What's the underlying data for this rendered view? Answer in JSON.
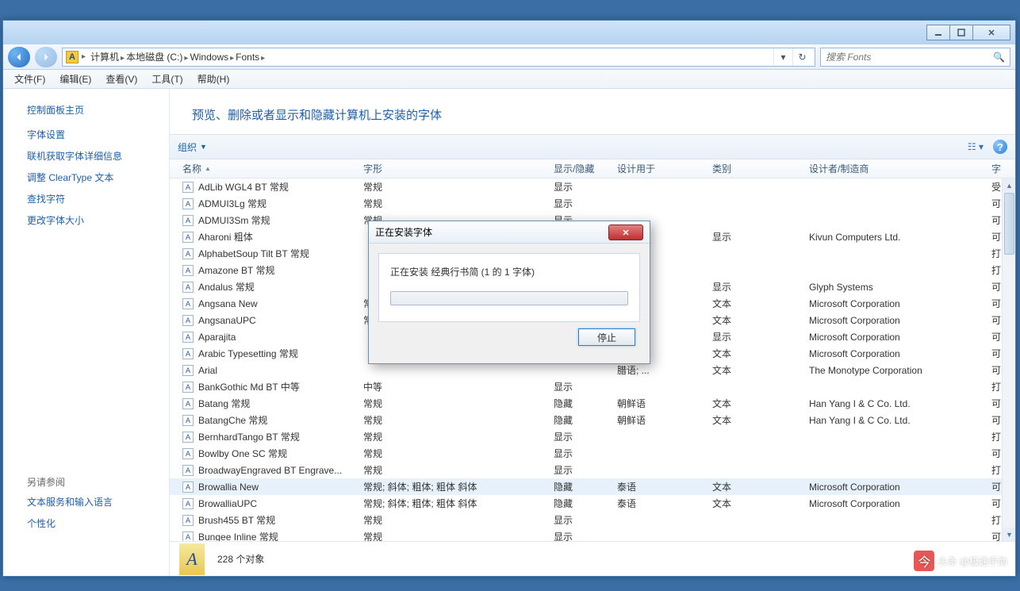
{
  "breadcrumb": [
    "计算机",
    "本地磁盘 (C:)",
    "Windows",
    "Fonts"
  ],
  "search_placeholder": "搜索 Fonts",
  "menubar": [
    "文件(F)",
    "编辑(E)",
    "查看(V)",
    "工具(T)",
    "帮助(H)"
  ],
  "sidebar": {
    "home": "控制面板主页",
    "links": [
      "字体设置",
      "联机获取字体详细信息",
      "调整 ClearType 文本",
      "查找字符",
      "更改字体大小"
    ],
    "seealso_label": "另请参阅",
    "seealso": [
      "文本服务和输入语言",
      "个性化"
    ]
  },
  "page_title": "预览、删除或者显示和隐藏计算机上安装的字体",
  "toolbar": {
    "organize": "组织"
  },
  "columns": {
    "name": "名称",
    "style": "字形",
    "show": "显示/隐藏",
    "design": "设计用于",
    "cat": "类别",
    "maker": "设计者/制造商",
    "emb": "字"
  },
  "fonts": [
    {
      "n": "AdLib WGL4 BT 常规",
      "s": "常规",
      "sh": "显示",
      "d": "",
      "c": "",
      "m": "",
      "e": "受"
    },
    {
      "n": "ADMUI3Lg 常规",
      "s": "常规",
      "sh": "显示",
      "d": "",
      "c": "",
      "m": "",
      "e": "可"
    },
    {
      "n": "ADMUI3Sm 常规",
      "s": "常规",
      "sh": "显示",
      "d": "",
      "c": "",
      "m": "",
      "e": "可"
    },
    {
      "n": "Aharoni 粗体",
      "s": "",
      "sh": "",
      "d": "",
      "c": "显示",
      "m": "Kivun Computers Ltd.",
      "e": "可"
    },
    {
      "n": "AlphabetSoup Tilt BT 常规",
      "s": "",
      "sh": "",
      "d": "",
      "c": "",
      "m": "",
      "e": "打"
    },
    {
      "n": "Amazone BT 常规",
      "s": "",
      "sh": "",
      "d": "",
      "c": "",
      "m": "",
      "e": "打"
    },
    {
      "n": "Andalus 常规",
      "s": "",
      "sh": "",
      "d": "",
      "c": "显示",
      "m": "Glyph Systems",
      "e": "可"
    },
    {
      "n": "Angsana New",
      "s": "常",
      "sh": "",
      "d": "",
      "c": "文本",
      "m": "Microsoft Corporation",
      "e": "可"
    },
    {
      "n": "AngsanaUPC",
      "s": "常",
      "sh": "",
      "d": "",
      "c": "文本",
      "m": "Microsoft Corporation",
      "e": "可"
    },
    {
      "n": "Aparajita",
      "s": "",
      "sh": "",
      "d": "",
      "c": "显示",
      "m": "Microsoft Corporation",
      "e": "可"
    },
    {
      "n": "Arabic Typesetting 常规",
      "s": "",
      "sh": "",
      "d": "",
      "c": "文本",
      "m": "Microsoft Corporation",
      "e": "可"
    },
    {
      "n": "Arial",
      "s": "",
      "sh": "",
      "d": "腊语; ...",
      "c": "文本",
      "m": "The Monotype Corporation",
      "e": "可"
    },
    {
      "n": "BankGothic Md BT 中等",
      "s": "中等",
      "sh": "显示",
      "d": "",
      "c": "",
      "m": "",
      "e": "打"
    },
    {
      "n": "Batang 常规",
      "s": "常规",
      "sh": "隐藏",
      "d": "朝鲜语",
      "c": "文本",
      "m": "Han Yang I & C Co. Ltd.",
      "e": "可"
    },
    {
      "n": "BatangChe 常规",
      "s": "常规",
      "sh": "隐藏",
      "d": "朝鲜语",
      "c": "文本",
      "m": "Han Yang I & C Co. Ltd.",
      "e": "可"
    },
    {
      "n": "BernhardTango BT 常规",
      "s": "常规",
      "sh": "显示",
      "d": "",
      "c": "",
      "m": "",
      "e": "打"
    },
    {
      "n": "Bowlby One SC 常规",
      "s": "常规",
      "sh": "显示",
      "d": "",
      "c": "",
      "m": "",
      "e": "可"
    },
    {
      "n": "BroadwayEngraved BT Engrave...",
      "s": "常规",
      "sh": "显示",
      "d": "",
      "c": "",
      "m": "",
      "e": "打"
    },
    {
      "n": "Browallia New",
      "s": "常规; 斜体; 粗体; 粗体 斜体",
      "sh": "隐藏",
      "d": "泰语",
      "c": "文本",
      "m": "Microsoft Corporation",
      "e": "可",
      "sel": true
    },
    {
      "n": "BrowalliaUPC",
      "s": "常规; 斜体; 粗体; 粗体 斜体",
      "sh": "隐藏",
      "d": "泰语",
      "c": "文本",
      "m": "Microsoft Corporation",
      "e": "可"
    },
    {
      "n": "Brush455 BT 常规",
      "s": "常规",
      "sh": "显示",
      "d": "",
      "c": "",
      "m": "",
      "e": "打"
    },
    {
      "n": "Bungee Inline 常规",
      "s": "常规",
      "sh": "显示",
      "d": "",
      "c": "",
      "m": "",
      "e": "可"
    }
  ],
  "status": "228 个对象",
  "dialog": {
    "title": "正在安装字体",
    "msg": "正在安装 经典行书简 (1 的 1 字体)",
    "stop": "停止"
  },
  "watermark": "头条 @极速手助"
}
